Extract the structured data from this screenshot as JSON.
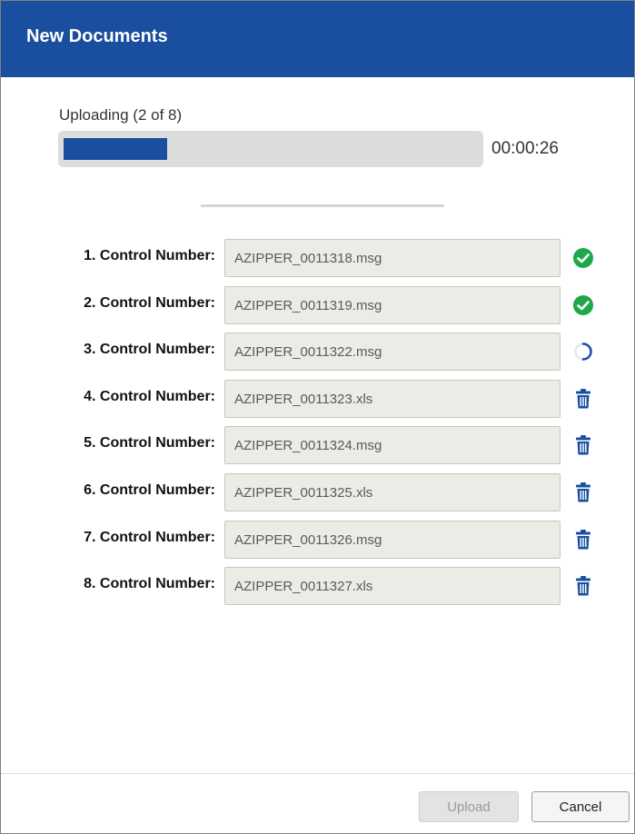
{
  "dialog": {
    "title": "New Documents"
  },
  "upload": {
    "status_label": "Uploading (2 of 8)",
    "progress_fraction": 0.25,
    "elapsed_time": "00:00:26",
    "progress_color": "#1a4fa0"
  },
  "documents": [
    {
      "label": "1. Control Number:",
      "value": "AZIPPER_0011318.msg",
      "status_icon": "check-circle-icon"
    },
    {
      "label": "2. Control Number:",
      "value": "AZIPPER_0011319.msg",
      "status_icon": "check-circle-icon"
    },
    {
      "label": "3. Control Number:",
      "value": "AZIPPER_0011322.msg",
      "status_icon": "spinner-icon"
    },
    {
      "label": "4. Control Number:",
      "value": "AZIPPER_0011323.xls",
      "status_icon": "trash-icon"
    },
    {
      "label": "5. Control Number:",
      "value": "AZIPPER_0011324.msg",
      "status_icon": "trash-icon"
    },
    {
      "label": "6. Control Number:",
      "value": "AZIPPER_0011325.xls",
      "status_icon": "trash-icon"
    },
    {
      "label": "7. Control Number:",
      "value": "AZIPPER_0011326.msg",
      "status_icon": "trash-icon"
    },
    {
      "label": "8. Control Number:",
      "value": "AZIPPER_0011327.xls",
      "status_icon": "trash-icon"
    }
  ],
  "colors": {
    "header": "#1a4fa0",
    "success": "#1fa84a",
    "trash": "#1a4fa0"
  },
  "footer": {
    "upload_label": "Upload",
    "cancel_label": "Cancel"
  }
}
